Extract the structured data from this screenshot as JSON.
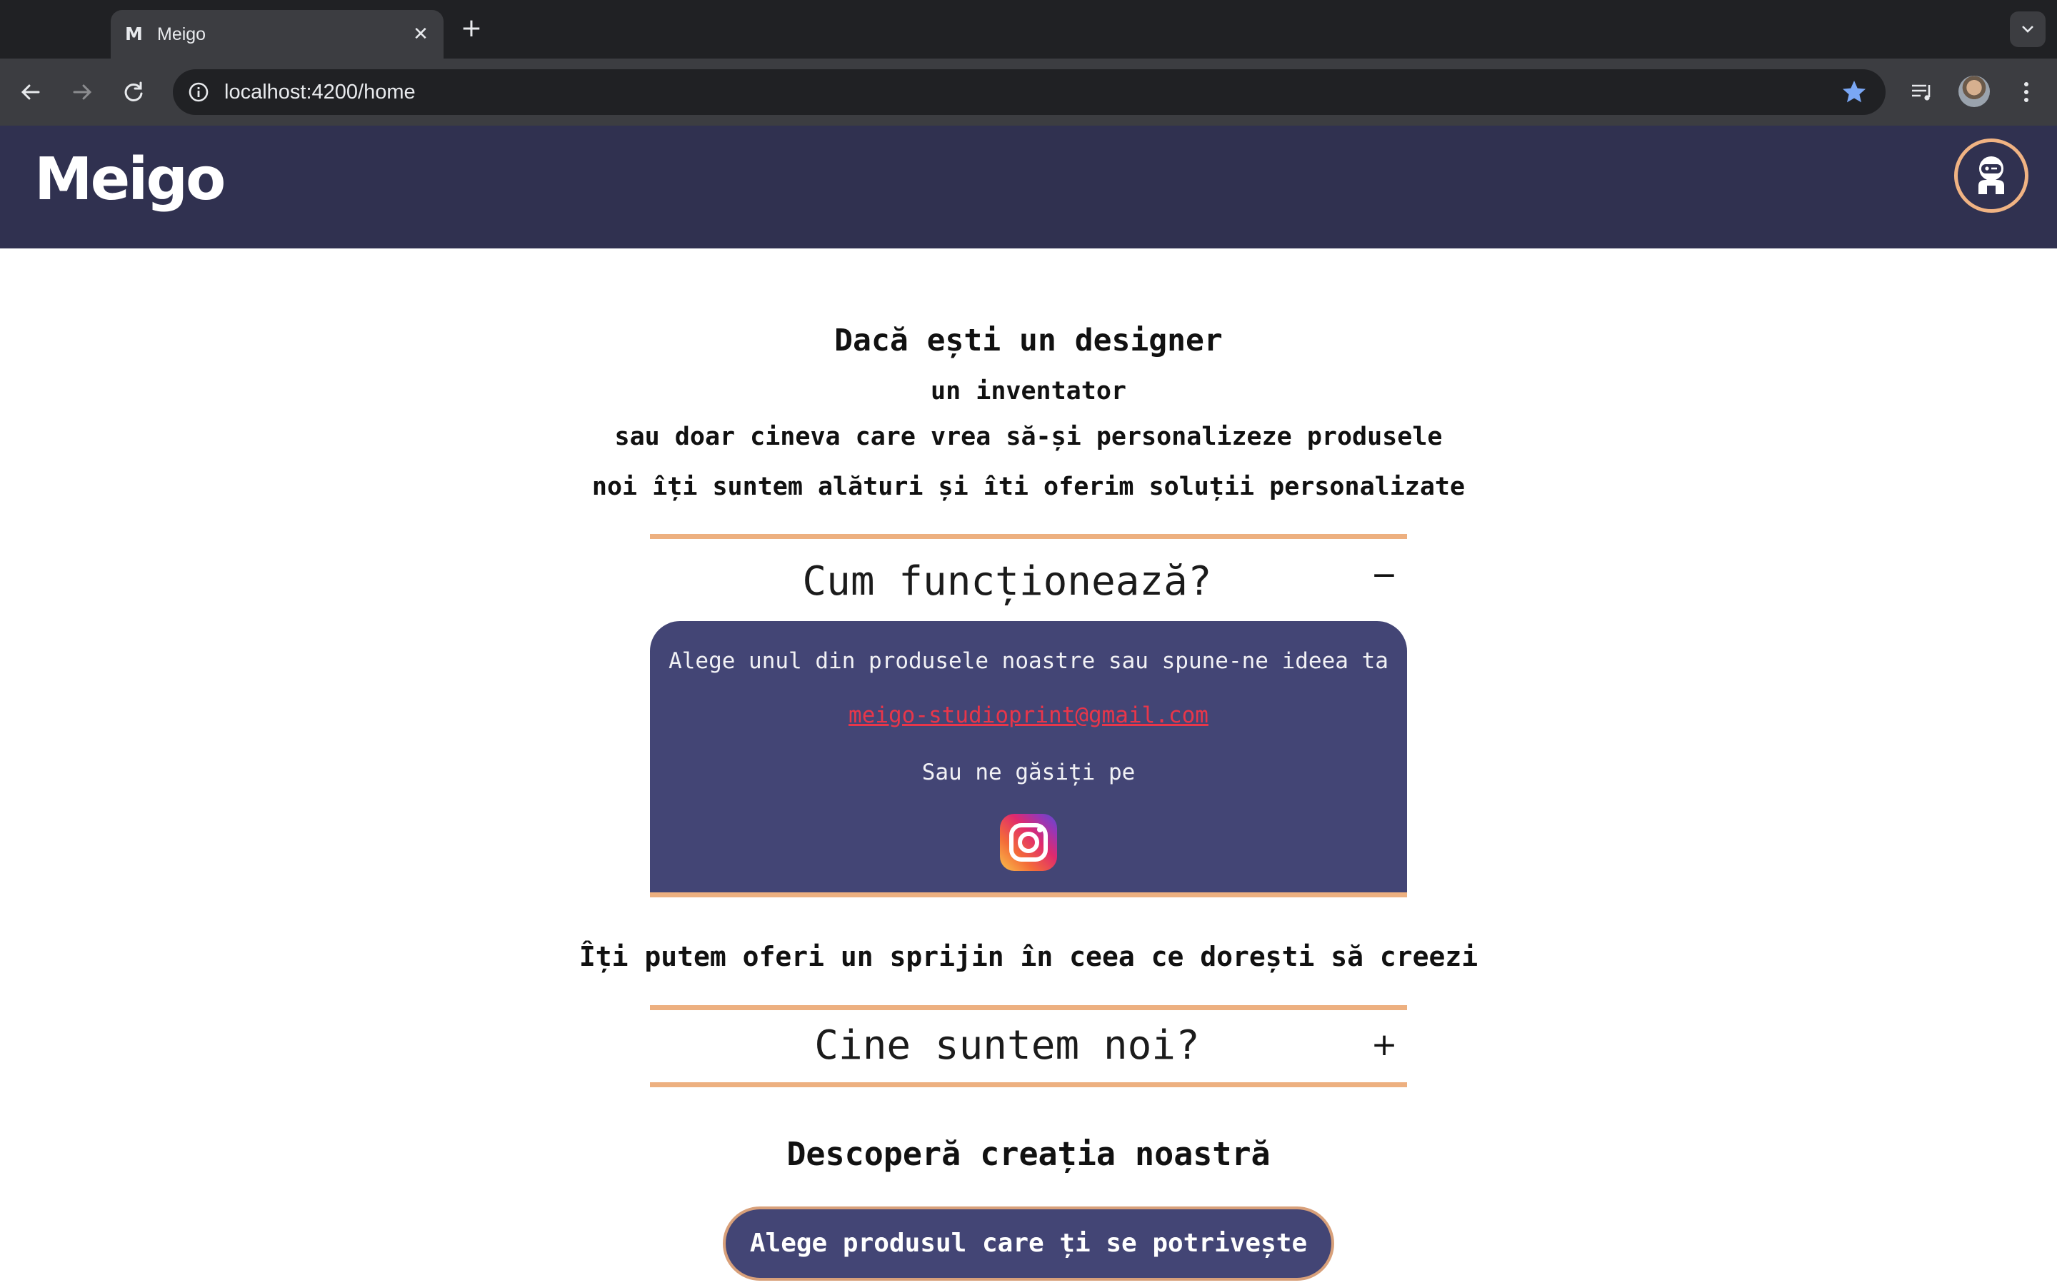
{
  "browser": {
    "tab_title": "Meigo",
    "tab_favicon": "M",
    "url": "localhost:4200/home",
    "icons": [
      "back-icon",
      "forward-icon",
      "reload-icon",
      "site-info-icon",
      "bookmark-star-icon",
      "media-controls-icon",
      "profile-avatar",
      "more-menu-icon",
      "tab-search-icon",
      "new-tab-icon",
      "close-tab-icon"
    ]
  },
  "site": {
    "logo": "Meigo",
    "account_icon": "robot-avatar-icon",
    "accent_color": "#edb080",
    "header_color": "#303150",
    "panel_color": "#434575"
  },
  "hero": {
    "line1": "Dacă ești un designer",
    "line2": "un inventator",
    "line3": "sau doar cineva care vrea să-și personalizeze produsele",
    "line4": "noi îți suntem alături și îti oferim soluții personalizate"
  },
  "how_it_works": {
    "title": "Cum funcționează?",
    "toggle": "−",
    "expanded": true,
    "text": "Alege unul din produsele noastre sau spune-ne ideea ta",
    "email": "meigo-studioprint@gmail.com",
    "find_us": "Sau ne găsiți pe",
    "social_icon": "instagram-icon"
  },
  "support_text": "Îți putem oferi un sprijin în ceea ce dorești să creezi",
  "who_we_are": {
    "title": "Cine suntem noi?",
    "toggle": "+",
    "expanded": false
  },
  "discover_text": "Descoperă creația noastră",
  "cta_label": "Alege produsul care ți se potrivește"
}
